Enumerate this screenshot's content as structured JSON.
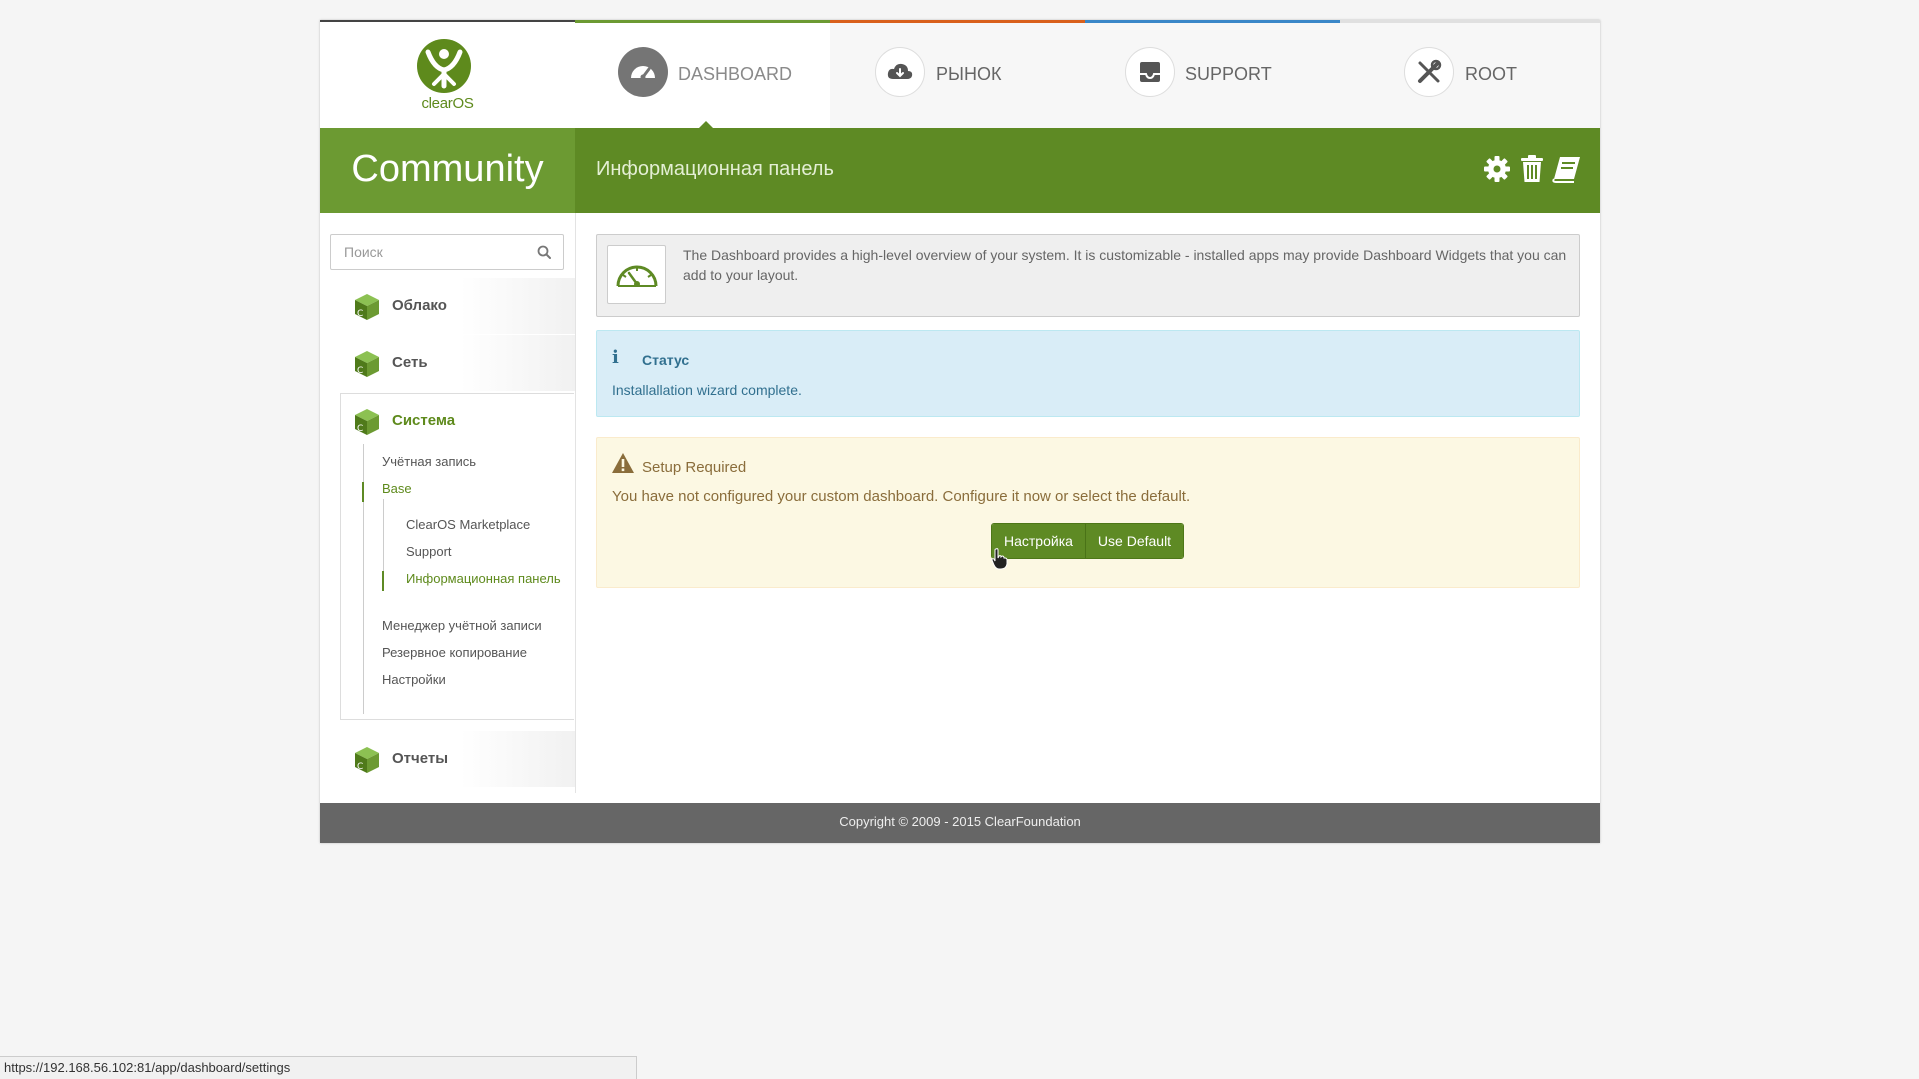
{
  "logo": {
    "text": "clearOS"
  },
  "top_tabs": [
    {
      "label": "DASHBOARD",
      "icon": "speedometer-icon",
      "accent": "#6c9a32"
    },
    {
      "label": "РЫНОК",
      "icon": "cloud-download-icon",
      "accent": "#d9601c"
    },
    {
      "label": "SUPPORT",
      "icon": "inbox-icon",
      "accent": "#3a87c8"
    },
    {
      "label": "ROOT",
      "icon": "tools-icon",
      "accent": "#e0e0e0"
    }
  ],
  "edition": "Community",
  "page_title": "Информационная панель",
  "header_actions": [
    {
      "icon": "gear-icon"
    },
    {
      "icon": "trash-icon"
    },
    {
      "icon": "book-icon"
    }
  ],
  "search": {
    "placeholder": "Поиск",
    "value": ""
  },
  "sidebar": {
    "categories": [
      {
        "label": "Облако"
      },
      {
        "label": "Сеть"
      },
      {
        "label": "Система"
      },
      {
        "label": "Отчеты"
      }
    ],
    "system_items": [
      {
        "label": "Учётная запись"
      },
      {
        "label": "Base"
      },
      {
        "label": "ClearOS Marketplace"
      },
      {
        "label": "Support"
      },
      {
        "label": "Информационная панель"
      },
      {
        "label": "Менеджер учётной записи"
      },
      {
        "label": "Резервное копирование"
      },
      {
        "label": "Настройки"
      }
    ]
  },
  "description": "The Dashboard provides a high-level overview of your system. It is customizable - installed apps may provide Dashboard Widgets that you can add to your layout.",
  "status_box": {
    "title": "Статус",
    "text": "Installallation wizard complete."
  },
  "setup_box": {
    "title": "Setup Required",
    "text": "You have not configured your custom dashboard. Configure it now or select the default.",
    "buttons": {
      "configure": "Настройка",
      "default": "Use Default"
    }
  },
  "footer": "Copyright © 2009 - 2015 ClearFoundation",
  "status_url": "https://192.168.56.102:81/app/dashboard/settings",
  "colors": {
    "brand_green": "#5e8a24",
    "info_bg": "#d9edf7",
    "warning_bg": "#fcf8e3"
  }
}
